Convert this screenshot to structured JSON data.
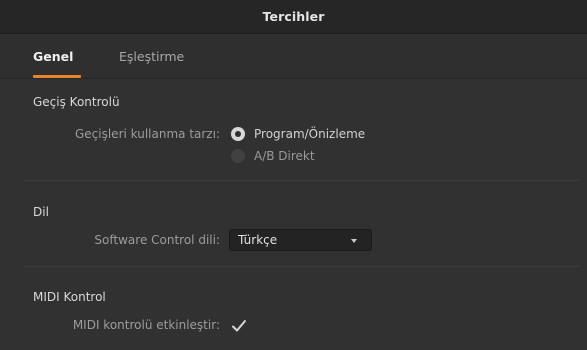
{
  "window": {
    "title": "Tercihler"
  },
  "tabs": [
    {
      "label": "Genel",
      "active": true
    },
    {
      "label": "Eşleştirme",
      "active": false
    }
  ],
  "sections": {
    "transition": {
      "title": "Geçiş Kontrolü",
      "label": "Geçişleri kullanma tarzı:",
      "options": [
        {
          "label": "Program/Önizleme",
          "selected": true
        },
        {
          "label": "A/B Direkt",
          "selected": false
        }
      ]
    },
    "language": {
      "title": "Dil",
      "label": "Software Control dili:",
      "value": "Türkçe"
    },
    "midi": {
      "title": "MIDI Kontrol",
      "label": "MIDI kontrolü etkinleştir:",
      "checked": true
    }
  },
  "colors": {
    "accent": "#e8832f",
    "background": "#313131",
    "titlebar": "#262626"
  }
}
